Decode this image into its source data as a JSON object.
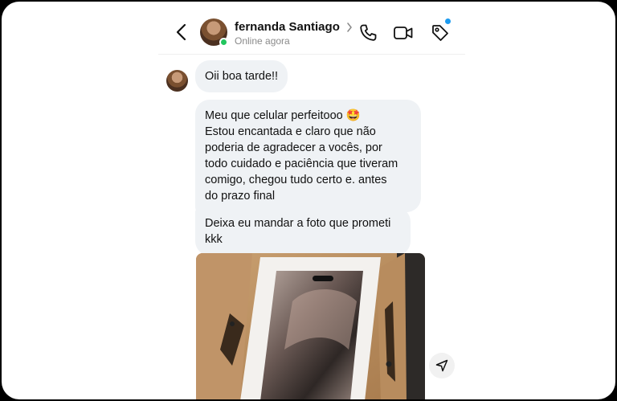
{
  "header": {
    "contact_name": "fernanda Santiago",
    "status": "Online agora",
    "icons": [
      "back-icon",
      "phone-icon",
      "video-icon",
      "tag-icon"
    ]
  },
  "messages": [
    {
      "type": "text",
      "text": "Oii boa tarde!!"
    },
    {
      "type": "text",
      "text": "Meu que celular perfeitooo 🤩\nEstou encantada e claro que não\npoderia de agradecer a vocês, por\ntodo cuidado e paciência que tiveram\ncomigo, chegou tudo certo e. antes\ndo prazo final"
    },
    {
      "type": "text",
      "text": "Deixa eu mandar a foto que prometi\nkkk"
    },
    {
      "type": "image",
      "subject": "new smartphone in opened box"
    }
  ],
  "colors": {
    "online": "#22c55e",
    "notification": "#1d9bf0",
    "bubble": "#eff2f5"
  }
}
